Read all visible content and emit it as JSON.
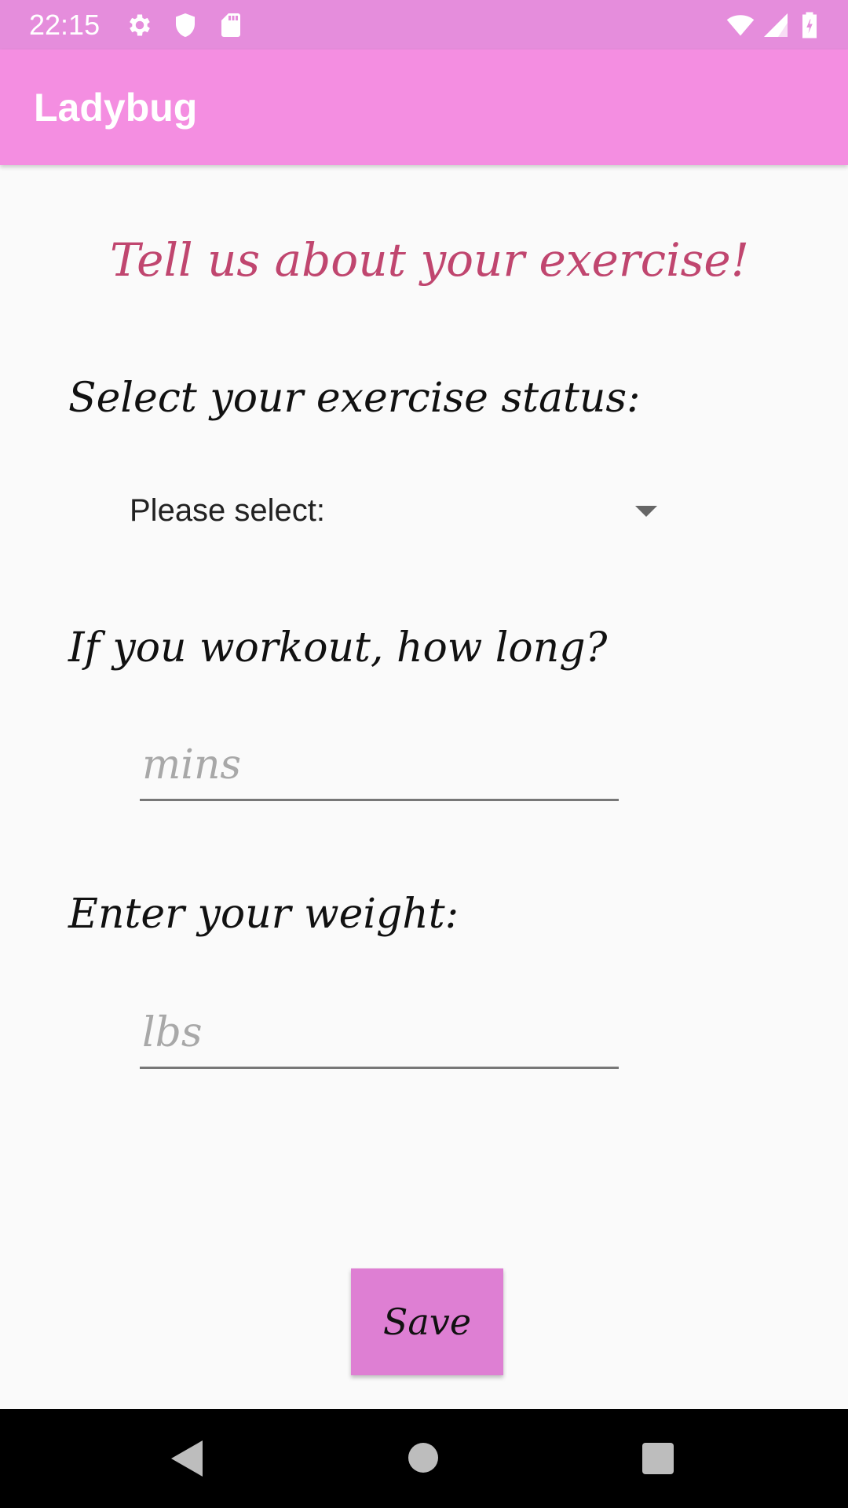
{
  "status_bar": {
    "time": "22:15",
    "icons": [
      "gear-icon",
      "shield-icon",
      "sd-card-icon",
      "wifi-icon",
      "signal-icon",
      "battery-icon"
    ]
  },
  "app_bar": {
    "title": "Ladybug"
  },
  "form": {
    "heading": "Tell us about your exercise!",
    "status_label": "Select your exercise status:",
    "status_selected": "Please select:",
    "workout_label": "If you workout, how long?",
    "workout_placeholder": "mins",
    "weight_label": "Enter your weight:",
    "weight_placeholder": "lbs",
    "save_label": "Save"
  },
  "nav_bar": {
    "icons": [
      "back-icon",
      "home-icon",
      "recents-icon"
    ]
  },
  "colors": {
    "status_bar": "#e58ddc",
    "app_bar": "#f48ee1",
    "heading": "#c0466f",
    "save_button": "#de7fd3",
    "background": "#fafafa"
  }
}
